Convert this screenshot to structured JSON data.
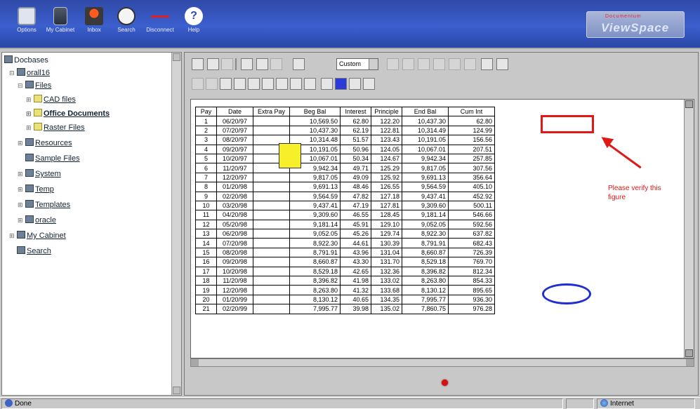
{
  "toolbar": {
    "buttons": [
      {
        "label": "Options",
        "icon": "options-icon"
      },
      {
        "label": "My Cabinet",
        "icon": "cabinet-icon"
      },
      {
        "label": "Inbox",
        "icon": "inbox-icon"
      },
      {
        "label": "Search",
        "icon": "search-icon"
      },
      {
        "label": "Disconnect",
        "icon": "disconnect-icon"
      },
      {
        "label": "Help",
        "icon": "help-icon"
      }
    ]
  },
  "logo": {
    "small": "Documentum",
    "big": "ViewSpace"
  },
  "tree": {
    "root": "Docbases",
    "items": [
      {
        "label": "orall16"
      },
      {
        "label": "Files"
      },
      {
        "label": "CAD files"
      },
      {
        "label": "Office Documents"
      },
      {
        "label": "Raster Files"
      },
      {
        "label": "Resources"
      },
      {
        "label": "Sample Files"
      },
      {
        "label": "System"
      },
      {
        "label": "Temp"
      },
      {
        "label": "Templates"
      },
      {
        "label": "oracle"
      },
      {
        "label": "My Cabinet"
      },
      {
        "label": "Search"
      }
    ]
  },
  "viewer": {
    "zoom_value": "Custom"
  },
  "table": {
    "headers": [
      "Pay",
      "Date",
      "Extra Pay",
      "Beg Bal",
      "Interest",
      "Principle",
      "End Bal",
      "Cum Int"
    ],
    "rows": [
      [
        "1",
        "06/20/97",
        "",
        "10,569.50",
        "62.80",
        "122.20",
        "10,437.30",
        "62.80"
      ],
      [
        "2",
        "07/20/97",
        "",
        "10,437.30",
        "62.19",
        "122.81",
        "10,314.49",
        "124.99"
      ],
      [
        "3",
        "08/20/97",
        "",
        "10,314.48",
        "51.57",
        "123.43",
        "10,191.05",
        "156.56"
      ],
      [
        "4",
        "09/20/97",
        "",
        "10,191.05",
        "50.96",
        "124.05",
        "10,067.01",
        "207.51"
      ],
      [
        "5",
        "10/20/97",
        "",
        "10,067.01",
        "50.34",
        "124.67",
        "9,942.34",
        "257.85"
      ],
      [
        "6",
        "11/20/97",
        "",
        "9,942.34",
        "49.71",
        "125.29",
        "9,817.05",
        "307.56"
      ],
      [
        "7",
        "12/20/97",
        "",
        "9,817.05",
        "49.09",
        "125.92",
        "9,691.13",
        "356.64"
      ],
      [
        "8",
        "01/20/98",
        "",
        "9,691.13",
        "48.46",
        "126.55",
        "9,564.59",
        "405.10"
      ],
      [
        "9",
        "02/20/98",
        "",
        "9,564.59",
        "47.82",
        "127.18",
        "9,437.41",
        "452.92"
      ],
      [
        "10",
        "03/20/98",
        "",
        "9,437.41",
        "47.19",
        "127.81",
        "9,309.60",
        "500.11"
      ],
      [
        "11",
        "04/20/98",
        "",
        "9,309.60",
        "46.55",
        "128.45",
        "9,181.14",
        "546.66"
      ],
      [
        "12",
        "05/20/98",
        "",
        "9,181.14",
        "45.91",
        "129.10",
        "9,052.05",
        "592.56"
      ],
      [
        "13",
        "06/20/98",
        "",
        "9,052.05",
        "45.26",
        "129.74",
        "8,922.30",
        "637.82"
      ],
      [
        "14",
        "07/20/98",
        "",
        "8,922.30",
        "44.61",
        "130.39",
        "8,791.91",
        "682.43"
      ],
      [
        "15",
        "08/20/98",
        "",
        "8,791.91",
        "43.96",
        "131.04",
        "8,660.87",
        "726.39"
      ],
      [
        "16",
        "09/20/98",
        "",
        "8,660.87",
        "43.30",
        "131.70",
        "8,529.18",
        "769.70"
      ],
      [
        "17",
        "10/20/98",
        "",
        "8,529.18",
        "42.65",
        "132.36",
        "8,396.82",
        "812.34"
      ],
      [
        "18",
        "11/20/98",
        "",
        "8,396.82",
        "41.98",
        "133.02",
        "8,263.80",
        "854.33"
      ],
      [
        "19",
        "12/20/98",
        "",
        "8,263.80",
        "41.32",
        "133.68",
        "8,130.12",
        "895.65"
      ],
      [
        "20",
        "01/20/99",
        "",
        "8,130.12",
        "40.65",
        "134.35",
        "7,995.77",
        "936.30"
      ],
      [
        "21",
        "02/20/99",
        "",
        "7,995.77",
        "39.98",
        "135.02",
        "7,860.75",
        "976.28"
      ]
    ]
  },
  "annotation": {
    "note": "Please verify this figure",
    "rect_color": "#e01818",
    "ellipse_color": "#1f2fd0",
    "sticky_color": "#f7ef2a"
  },
  "statusbar": {
    "left": "Done",
    "zone": "Internet"
  }
}
